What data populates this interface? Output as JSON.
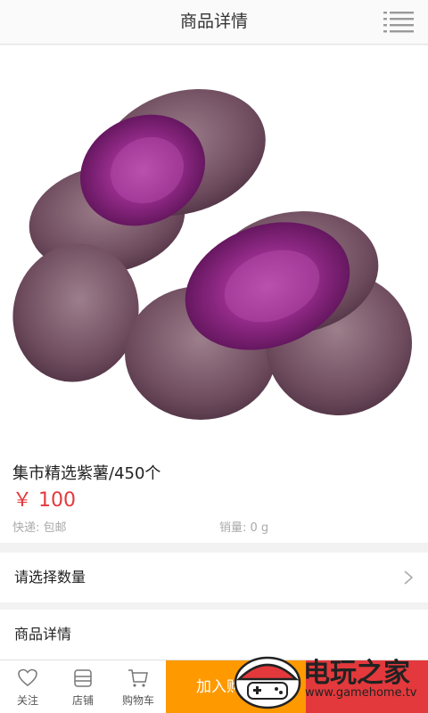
{
  "header": {
    "title": "商品详情",
    "menu_icon": "list-menu-icon"
  },
  "product": {
    "image": "purple-sweet-potato-photo",
    "name": "集市精选紫薯/450个",
    "price": "￥ 100",
    "shipping": "快递: 包邮",
    "sales": "销量: 0 g"
  },
  "options": {
    "quantity_label": "请选择数量"
  },
  "details": {
    "label": "商品详情"
  },
  "tabbar": {
    "follow": "关注",
    "store": "店铺",
    "cart": "购物车",
    "add_to_cart": "加入购"
  },
  "watermark": {
    "text": "电玩之家",
    "url": "www.gamehome.tv"
  },
  "colors": {
    "price": "#e4393c",
    "add_to_cart": "#ff9900",
    "buy_now": "#e4393c"
  }
}
